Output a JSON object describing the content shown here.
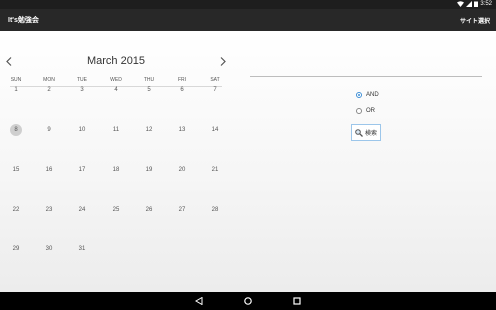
{
  "statusbar": {
    "time": "3:52"
  },
  "appbar": {
    "title": "It's勉強会",
    "action": "サイト選択"
  },
  "calendar": {
    "month_title": "March 2015",
    "weekdays": [
      "SUN",
      "MON",
      "TUE",
      "WED",
      "THU",
      "FRI",
      "SAT"
    ],
    "weeks": [
      [
        "1",
        "2",
        "3",
        "4",
        "5",
        "6",
        "7"
      ],
      [
        "8",
        "9",
        "10",
        "11",
        "12",
        "13",
        "14"
      ],
      [
        "15",
        "16",
        "17",
        "18",
        "19",
        "20",
        "21"
      ],
      [
        "22",
        "23",
        "24",
        "25",
        "26",
        "27",
        "28"
      ],
      [
        "29",
        "30",
        "31",
        "",
        "",
        "",
        ""
      ]
    ],
    "selected_day": "8"
  },
  "search": {
    "query_value": "",
    "options": [
      {
        "label": "AND",
        "checked": true
      },
      {
        "label": "OR",
        "checked": false
      }
    ],
    "button_label": "検索"
  },
  "colors": {
    "accent": "#3f8fd6",
    "appbar": "#282828",
    "statusbar": "#1e1e1e"
  },
  "icons": {
    "prev": "chevron-left-icon",
    "next": "chevron-right-icon",
    "search": "magnifier-icon",
    "nav_back": "back-triangle-icon",
    "nav_home": "home-circle-icon",
    "nav_recent": "recents-square-icon"
  }
}
